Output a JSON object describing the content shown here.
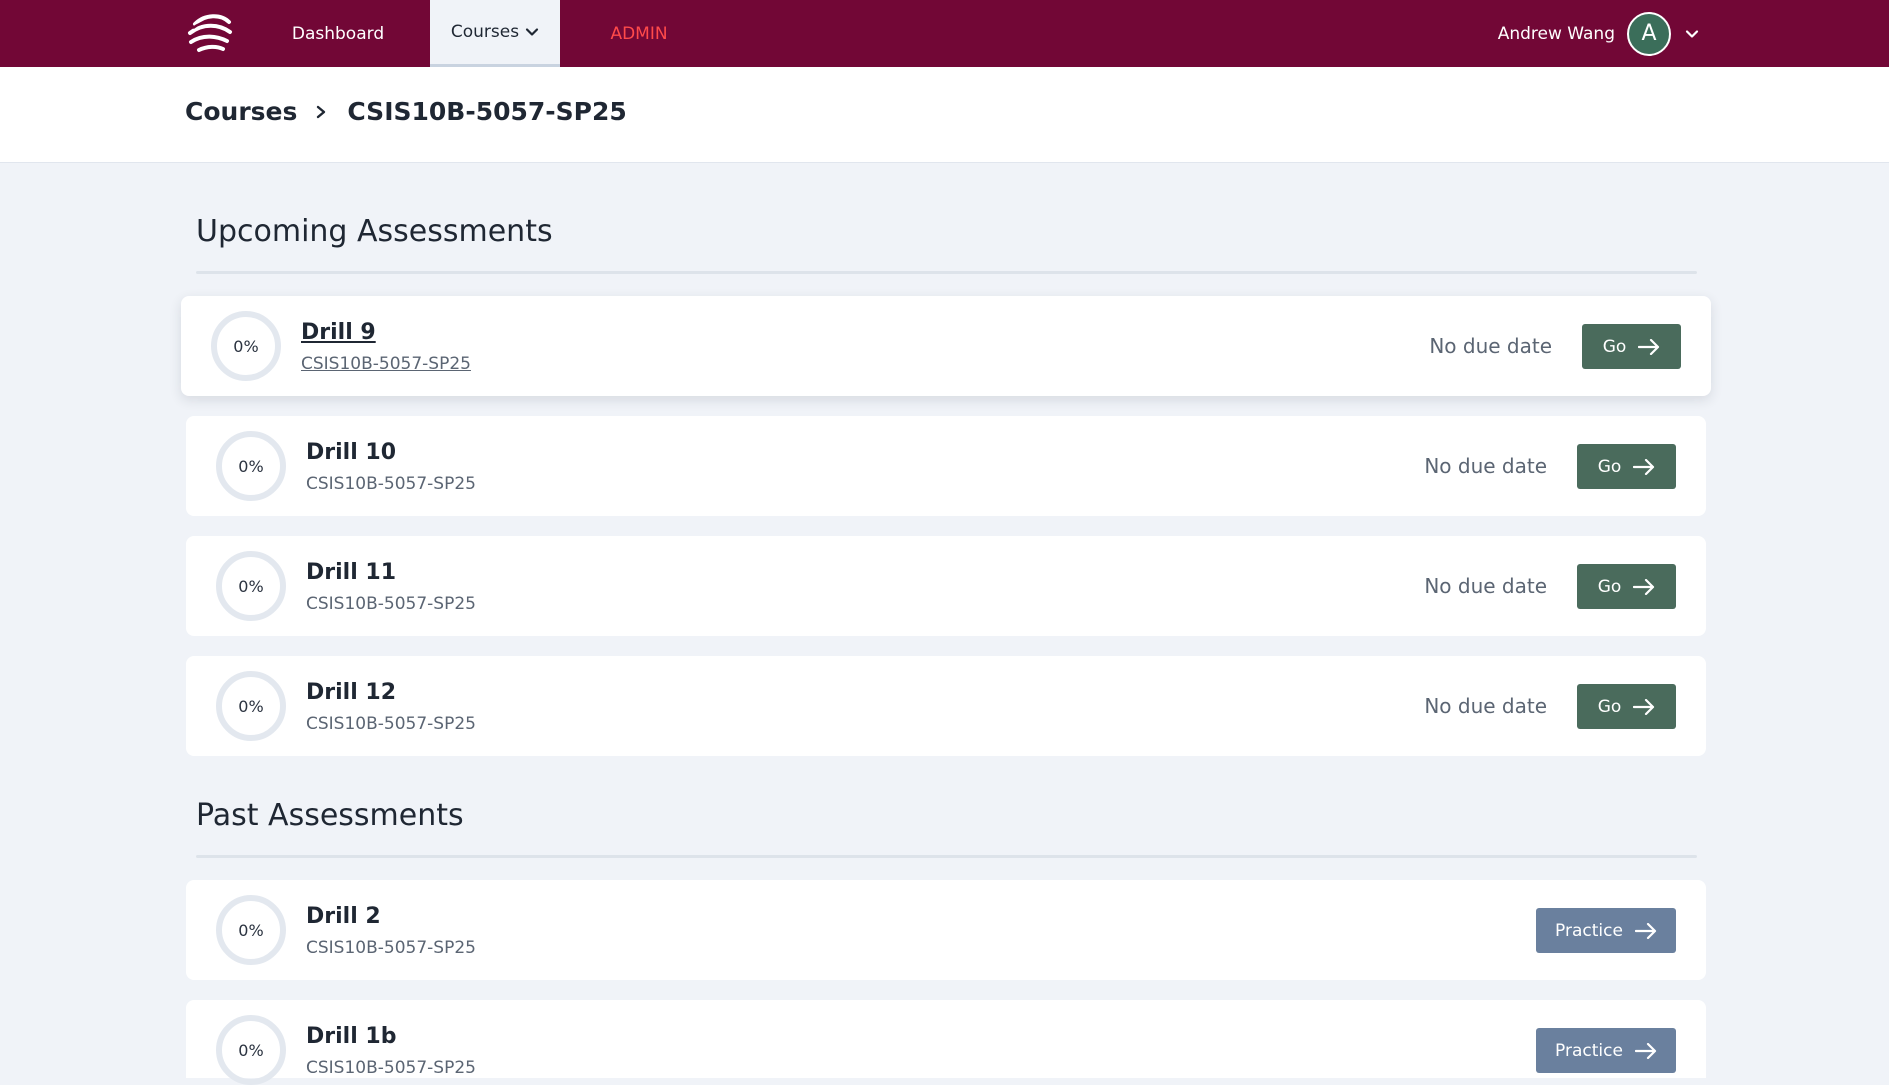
{
  "nav": {
    "dashboard": "Dashboard",
    "courses": "Courses",
    "admin": "ADMIN",
    "user_name": "Andrew Wang",
    "avatar_initial": "A",
    "brand_color": "#720736",
    "admin_color": "#ff4a4a"
  },
  "breadcrumb": {
    "root": "Courses",
    "current": "CSIS10B-5057-SP25"
  },
  "upcoming": {
    "title": "Upcoming Assessments",
    "items": [
      {
        "progress": "0%",
        "title": "Drill 9",
        "course": "CSIS10B-5057-SP25",
        "due": "No due date",
        "action": "Go"
      },
      {
        "progress": "0%",
        "title": "Drill 10",
        "course": "CSIS10B-5057-SP25",
        "due": "No due date",
        "action": "Go"
      },
      {
        "progress": "0%",
        "title": "Drill 11",
        "course": "CSIS10B-5057-SP25",
        "due": "No due date",
        "action": "Go"
      },
      {
        "progress": "0%",
        "title": "Drill 12",
        "course": "CSIS10B-5057-SP25",
        "due": "No due date",
        "action": "Go"
      }
    ]
  },
  "past": {
    "title": "Past Assessments",
    "items": [
      {
        "progress": "0%",
        "title": "Drill 2",
        "course": "CSIS10B-5057-SP25",
        "action": "Practice"
      },
      {
        "progress": "0%",
        "title": "Drill 1b",
        "course": "CSIS10B-5057-SP25",
        "action": "Practice"
      }
    ]
  },
  "colors": {
    "go_button": "#4a6b5c",
    "practice_button": "#6a809e",
    "page_bg": "#f0f3f8"
  }
}
